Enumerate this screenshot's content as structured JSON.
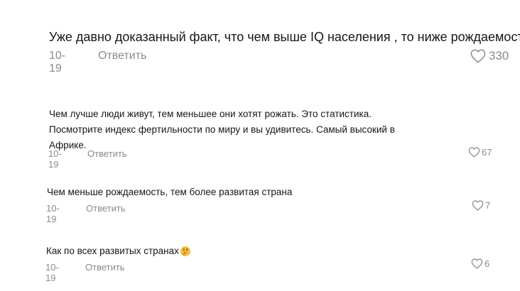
{
  "comments": [
    {
      "text": "Уже давно доказанный факт, что чем выше IQ населения , то ниже рождаемость",
      "date": "10-19",
      "reply": "Ответить",
      "likes": "330"
    },
    {
      "text": "Чем лучше люди живут, тем меньшее они хотят рожать. Это статистика. Посмотрите индекс фертильности по миру и вы удивитесь. Самый высокий в Африке.",
      "date": "10-19",
      "reply": "Ответить",
      "likes": "67"
    },
    {
      "text": "Чем меньше рождаемость, тем более развитая страна",
      "date": "10-19",
      "reply": "Ответить",
      "likes": "7"
    },
    {
      "text": "Как по всех развитых странах",
      "emoji": "thinking-face-icon",
      "date": "10-19",
      "reply": "Ответить",
      "likes": "6"
    }
  ],
  "colors": {
    "text": "#161616",
    "meta": "#8a8a8a",
    "background": "#ffffff"
  },
  "icons": {
    "like": "heart-outline-icon"
  }
}
